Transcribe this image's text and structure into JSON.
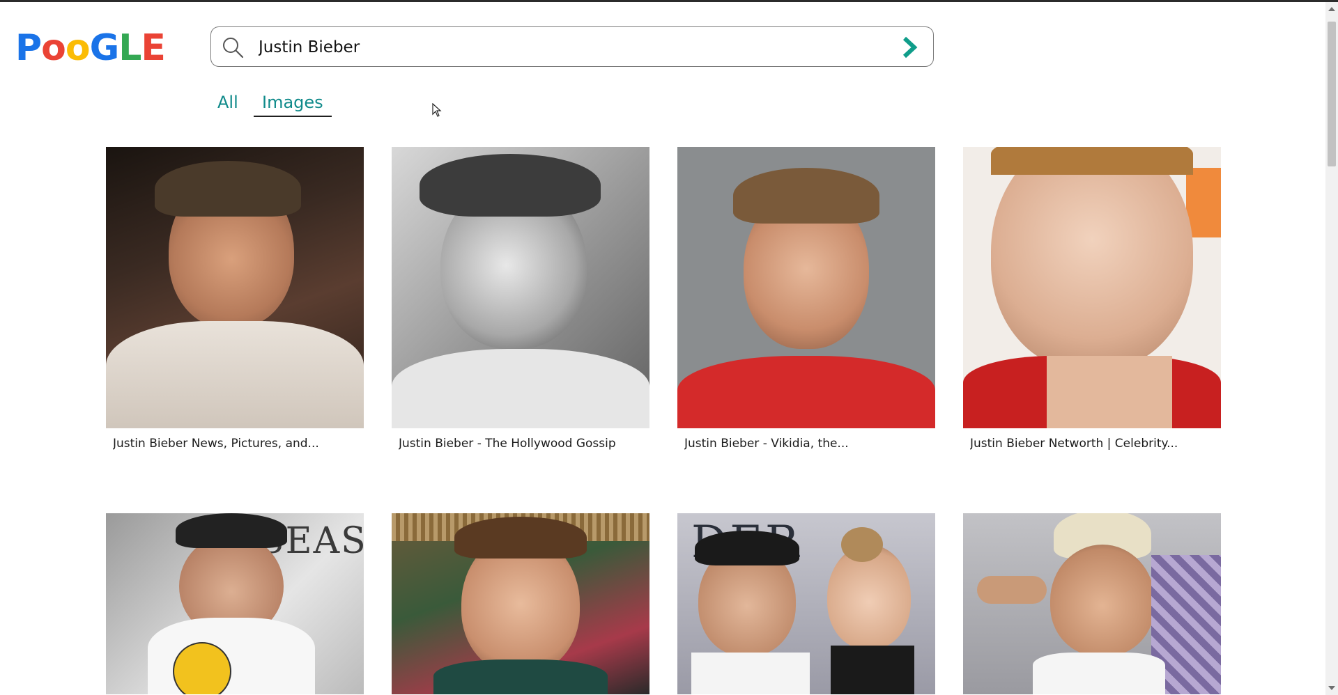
{
  "logo": {
    "letters": [
      {
        "char": "P",
        "color": "#1a73e8"
      },
      {
        "char": "o",
        "color": "#ea4335"
      },
      {
        "char": "o",
        "color": "#fbbc05"
      },
      {
        "char": "G",
        "color": "#1a73e8"
      },
      {
        "char": "L",
        "color": "#34a853"
      },
      {
        "char": "E",
        "color": "#ea4335"
      }
    ]
  },
  "search": {
    "value": "Justin Bieber",
    "icon": "search-icon",
    "submit_icon": "chevron-right-icon",
    "submit_color": "#0f9d8a"
  },
  "tabs": [
    {
      "label": "All",
      "active": false
    },
    {
      "label": "Images",
      "active": true
    }
  ],
  "accent_color": "#0f8a8a",
  "results": [
    {
      "caption": "Justin Bieber News, Pictures, and..."
    },
    {
      "caption": "Justin Bieber - The Hollywood Gossip"
    },
    {
      "caption": "Justin Bieber - Vikidia, the..."
    },
    {
      "caption": "Justin Bieber Networth | Celebrity..."
    },
    {
      "caption": ""
    },
    {
      "caption": ""
    },
    {
      "caption": ""
    },
    {
      "caption": ""
    }
  ]
}
